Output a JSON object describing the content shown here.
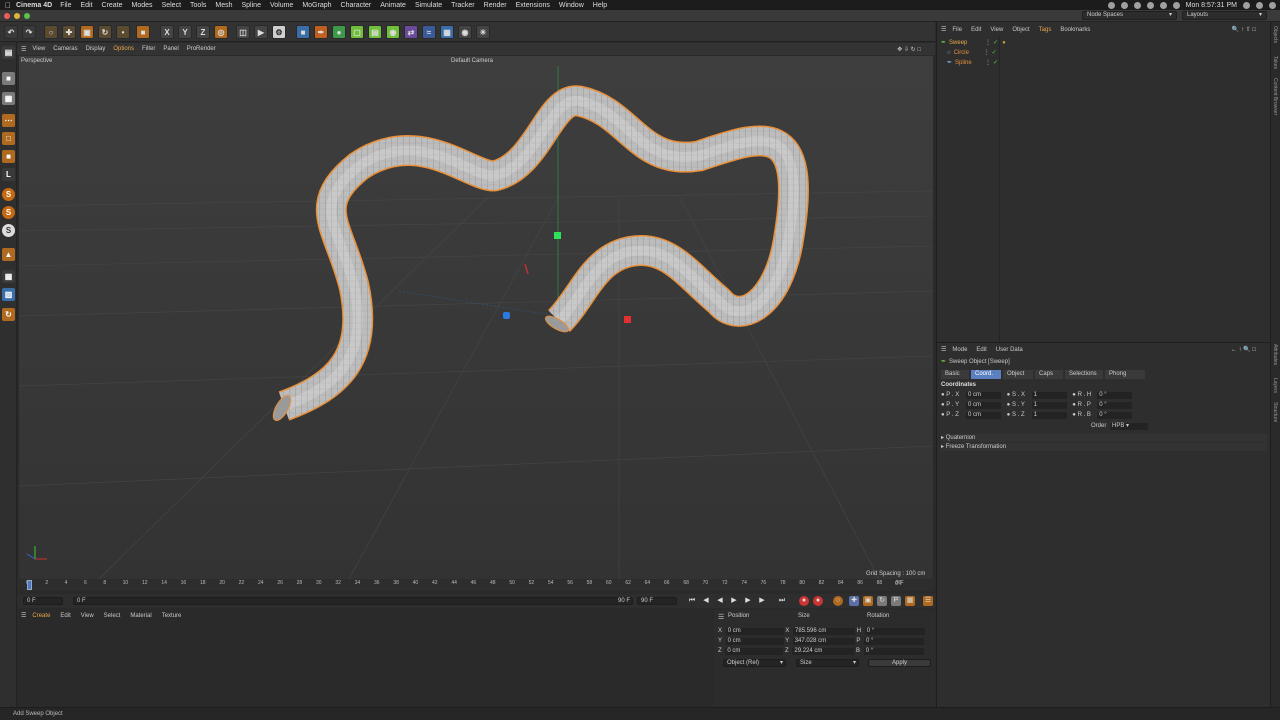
{
  "menubar": {
    "app": "Cinema 4D",
    "items": [
      "File",
      "Edit",
      "Create",
      "Modes",
      "Select",
      "Tools",
      "Mesh",
      "Spline",
      "Volume",
      "MoGraph",
      "Character",
      "Animate",
      "Simulate",
      "Tracker",
      "Render",
      "Extensions",
      "Window",
      "Help"
    ],
    "clock": "Mon 8:57:31 PM"
  },
  "titlebar": {
    "node_spaces": "Node Spaces",
    "layouts": "Layouts"
  },
  "viewport": {
    "menu": [
      "View",
      "Cameras",
      "Display",
      "Options",
      "Filter",
      "Panel",
      "ProRender"
    ],
    "projection": "Perspective",
    "camera": "Default Camera",
    "grid_spacing": "Grid Spacing : 100 cm"
  },
  "timeline": {
    "ticks": [
      "0",
      "2",
      "4",
      "6",
      "8",
      "10",
      "12",
      "14",
      "16",
      "18",
      "20",
      "22",
      "24",
      "26",
      "28",
      "30",
      "32",
      "34",
      "36",
      "38",
      "40",
      "42",
      "44",
      "46",
      "48",
      "50",
      "52",
      "54",
      "56",
      "58",
      "60",
      "62",
      "64",
      "66",
      "68",
      "70",
      "72",
      "74",
      "76",
      "78",
      "80",
      "82",
      "84",
      "86",
      "88",
      "90"
    ],
    "current_frame_label": "0 F",
    "start": "0 F",
    "preview_start": "0 F",
    "preview_end": "90 F",
    "end": "90 F"
  },
  "material": {
    "menu": [
      "Create",
      "Edit",
      "View",
      "Select",
      "Material",
      "Texture"
    ]
  },
  "coords": {
    "headers": {
      "position": "Position",
      "size": "Size",
      "rotation": "Rotation"
    },
    "rows": [
      {
        "axis": "X",
        "pos": "0 cm",
        "saxis": "X",
        "size": "785.596 cm",
        "raxis": "H",
        "rot": "0 °"
      },
      {
        "axis": "Y",
        "pos": "0 cm",
        "saxis": "Y",
        "size": "347.028 cm",
        "raxis": "P",
        "rot": "0 °"
      },
      {
        "axis": "Z",
        "pos": "0 cm",
        "saxis": "Z",
        "size": "29.224 cm",
        "raxis": "B",
        "rot": "0 °"
      }
    ],
    "mode": "Object (Rel)",
    "size_mode": "Size",
    "apply": "Apply"
  },
  "objects": {
    "menu": [
      "File",
      "Edit",
      "View",
      "Object",
      "Tags",
      "Bookmarks"
    ],
    "items": [
      "Sweep",
      "Circle",
      "Spline"
    ]
  },
  "attributes": {
    "menu": [
      "Mode",
      "Edit",
      "User Data"
    ],
    "title": "Sweep Object [Sweep]",
    "tabs": [
      "Basic",
      "Coord.",
      "Object",
      "Caps",
      "Selections",
      "Phong"
    ],
    "active_tab": "Coord.",
    "section": "Coordinates",
    "rows": [
      {
        "p": "P . X",
        "pv": "0 cm",
        "s": "S . X",
        "sv": "1",
        "r": "R . H",
        "rv": "0 °"
      },
      {
        "p": "P . Y",
        "pv": "0 cm",
        "s": "S . Y",
        "sv": "1",
        "r": "R . P",
        "rv": "0 °"
      },
      {
        "p": "P . Z",
        "pv": "0 cm",
        "s": "S . Z",
        "sv": "1",
        "r": "R . B",
        "rv": "0 °"
      }
    ],
    "order_label": "Order",
    "order_value": "HPB",
    "groups": [
      "Quaternion",
      "Freeze Transformation"
    ]
  },
  "sidebar": {
    "top": [
      "Objects",
      "Takes",
      "Content Browser"
    ],
    "bottom": [
      "Attributes",
      "Layers",
      "Structure"
    ]
  },
  "status": "Add Sweep Object",
  "colors": {
    "accent": "#5b7fc0",
    "selection": "#e8903a",
    "object_name": "#e8a84a"
  }
}
